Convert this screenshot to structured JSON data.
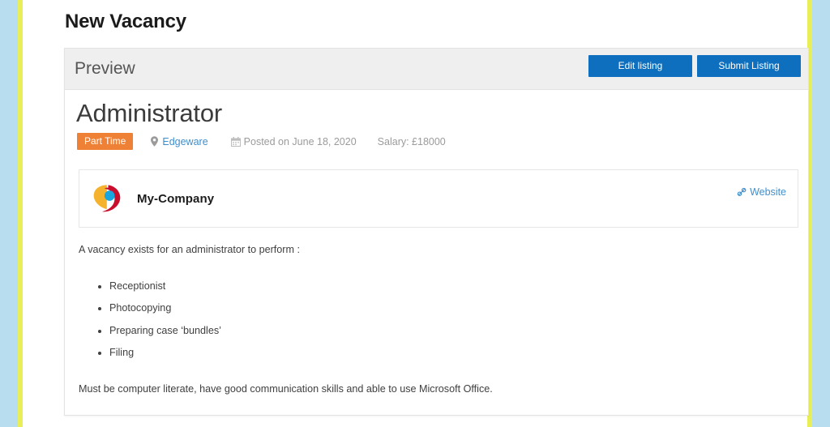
{
  "theme": {
    "frame_blue": "#b8ddee",
    "frame_yellow": "#e7ee58",
    "button_blue": "#0e6fbf",
    "badge_orange": "#ef8136",
    "link_blue": "#3f8fce",
    "panel_header_gray": "#efefef"
  },
  "page": {
    "title": "New Vacancy"
  },
  "panel": {
    "heading": "Preview",
    "actions": {
      "edit_label": "Edit listing",
      "submit_label": "Submit Listing"
    }
  },
  "job": {
    "title": "Administrator",
    "badge": "Part Time",
    "location": "Edgeware",
    "location_icon": "map-marker-icon",
    "date_icon": "calendar-icon",
    "posted": "Posted on June 18, 2020",
    "salary": "Salary: £18000"
  },
  "company": {
    "name": "My-Company",
    "logo_icon": "company-logo-icon",
    "website_label": "Website",
    "website_icon": "link-icon"
  },
  "description": {
    "intro": "A vacancy exists for an administrator to perform :",
    "duties": [
      "Receptionist",
      "Photocopying",
      "Preparing case ‘bundles’",
      "Filing"
    ],
    "outro": "Must be computer literate, have good communication skills and able to use Microsoft Office."
  }
}
